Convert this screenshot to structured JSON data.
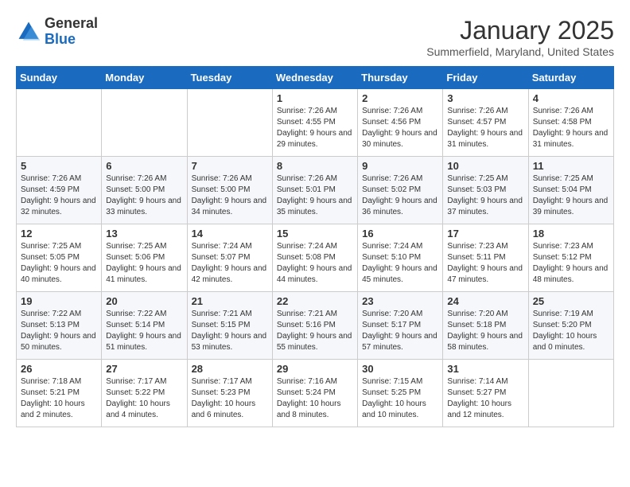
{
  "header": {
    "logo_general": "General",
    "logo_blue": "Blue",
    "month_title": "January 2025",
    "subtitle": "Summerfield, Maryland, United States"
  },
  "days_of_week": [
    "Sunday",
    "Monday",
    "Tuesday",
    "Wednesday",
    "Thursday",
    "Friday",
    "Saturday"
  ],
  "weeks": [
    [
      {
        "day": "",
        "content": ""
      },
      {
        "day": "",
        "content": ""
      },
      {
        "day": "",
        "content": ""
      },
      {
        "day": "1",
        "content": "Sunrise: 7:26 AM\nSunset: 4:55 PM\nDaylight: 9 hours and 29 minutes."
      },
      {
        "day": "2",
        "content": "Sunrise: 7:26 AM\nSunset: 4:56 PM\nDaylight: 9 hours and 30 minutes."
      },
      {
        "day": "3",
        "content": "Sunrise: 7:26 AM\nSunset: 4:57 PM\nDaylight: 9 hours and 31 minutes."
      },
      {
        "day": "4",
        "content": "Sunrise: 7:26 AM\nSunset: 4:58 PM\nDaylight: 9 hours and 31 minutes."
      }
    ],
    [
      {
        "day": "5",
        "content": "Sunrise: 7:26 AM\nSunset: 4:59 PM\nDaylight: 9 hours and 32 minutes."
      },
      {
        "day": "6",
        "content": "Sunrise: 7:26 AM\nSunset: 5:00 PM\nDaylight: 9 hours and 33 minutes."
      },
      {
        "day": "7",
        "content": "Sunrise: 7:26 AM\nSunset: 5:00 PM\nDaylight: 9 hours and 34 minutes."
      },
      {
        "day": "8",
        "content": "Sunrise: 7:26 AM\nSunset: 5:01 PM\nDaylight: 9 hours and 35 minutes."
      },
      {
        "day": "9",
        "content": "Sunrise: 7:26 AM\nSunset: 5:02 PM\nDaylight: 9 hours and 36 minutes."
      },
      {
        "day": "10",
        "content": "Sunrise: 7:25 AM\nSunset: 5:03 PM\nDaylight: 9 hours and 37 minutes."
      },
      {
        "day": "11",
        "content": "Sunrise: 7:25 AM\nSunset: 5:04 PM\nDaylight: 9 hours and 39 minutes."
      }
    ],
    [
      {
        "day": "12",
        "content": "Sunrise: 7:25 AM\nSunset: 5:05 PM\nDaylight: 9 hours and 40 minutes."
      },
      {
        "day": "13",
        "content": "Sunrise: 7:25 AM\nSunset: 5:06 PM\nDaylight: 9 hours and 41 minutes."
      },
      {
        "day": "14",
        "content": "Sunrise: 7:24 AM\nSunset: 5:07 PM\nDaylight: 9 hours and 42 minutes."
      },
      {
        "day": "15",
        "content": "Sunrise: 7:24 AM\nSunset: 5:08 PM\nDaylight: 9 hours and 44 minutes."
      },
      {
        "day": "16",
        "content": "Sunrise: 7:24 AM\nSunset: 5:10 PM\nDaylight: 9 hours and 45 minutes."
      },
      {
        "day": "17",
        "content": "Sunrise: 7:23 AM\nSunset: 5:11 PM\nDaylight: 9 hours and 47 minutes."
      },
      {
        "day": "18",
        "content": "Sunrise: 7:23 AM\nSunset: 5:12 PM\nDaylight: 9 hours and 48 minutes."
      }
    ],
    [
      {
        "day": "19",
        "content": "Sunrise: 7:22 AM\nSunset: 5:13 PM\nDaylight: 9 hours and 50 minutes."
      },
      {
        "day": "20",
        "content": "Sunrise: 7:22 AM\nSunset: 5:14 PM\nDaylight: 9 hours and 51 minutes."
      },
      {
        "day": "21",
        "content": "Sunrise: 7:21 AM\nSunset: 5:15 PM\nDaylight: 9 hours and 53 minutes."
      },
      {
        "day": "22",
        "content": "Sunrise: 7:21 AM\nSunset: 5:16 PM\nDaylight: 9 hours and 55 minutes."
      },
      {
        "day": "23",
        "content": "Sunrise: 7:20 AM\nSunset: 5:17 PM\nDaylight: 9 hours and 57 minutes."
      },
      {
        "day": "24",
        "content": "Sunrise: 7:20 AM\nSunset: 5:18 PM\nDaylight: 9 hours and 58 minutes."
      },
      {
        "day": "25",
        "content": "Sunrise: 7:19 AM\nSunset: 5:20 PM\nDaylight: 10 hours and 0 minutes."
      }
    ],
    [
      {
        "day": "26",
        "content": "Sunrise: 7:18 AM\nSunset: 5:21 PM\nDaylight: 10 hours and 2 minutes."
      },
      {
        "day": "27",
        "content": "Sunrise: 7:17 AM\nSunset: 5:22 PM\nDaylight: 10 hours and 4 minutes."
      },
      {
        "day": "28",
        "content": "Sunrise: 7:17 AM\nSunset: 5:23 PM\nDaylight: 10 hours and 6 minutes."
      },
      {
        "day": "29",
        "content": "Sunrise: 7:16 AM\nSunset: 5:24 PM\nDaylight: 10 hours and 8 minutes."
      },
      {
        "day": "30",
        "content": "Sunrise: 7:15 AM\nSunset: 5:25 PM\nDaylight: 10 hours and 10 minutes."
      },
      {
        "day": "31",
        "content": "Sunrise: 7:14 AM\nSunset: 5:27 PM\nDaylight: 10 hours and 12 minutes."
      },
      {
        "day": "",
        "content": ""
      }
    ]
  ]
}
